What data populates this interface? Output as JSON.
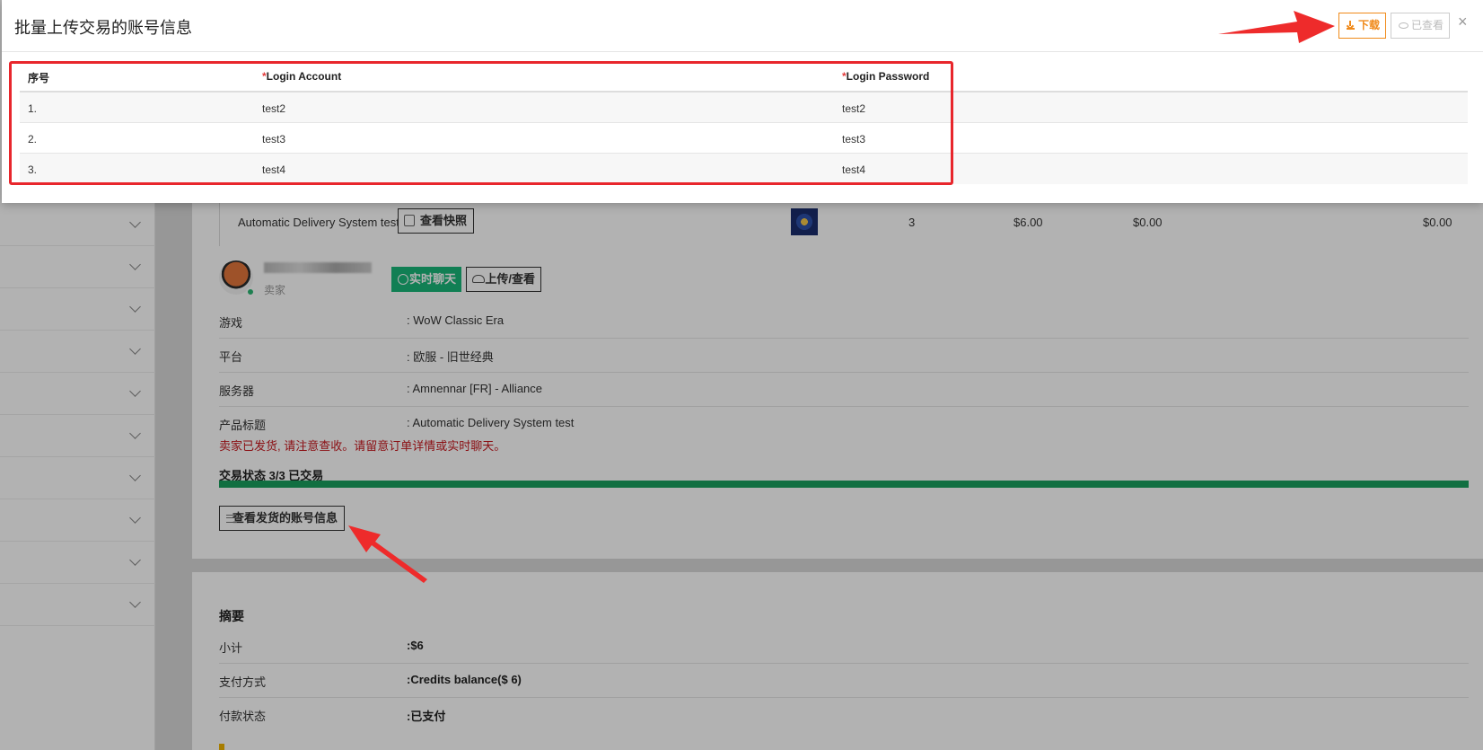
{
  "modal": {
    "title": "批量上传交易的账号信息",
    "download_label": "下载",
    "viewed_label": "已查看",
    "close_symbol": "×",
    "table": {
      "headers": {
        "index": "序号",
        "account": "Login Account",
        "password": "Login Password"
      },
      "required_mark": "*",
      "rows": [
        {
          "index": "1.",
          "account": "test2",
          "password": "test2"
        },
        {
          "index": "2.",
          "account": "test3",
          "password": "test3"
        },
        {
          "index": "3.",
          "account": "test4",
          "password": "test4"
        }
      ]
    }
  },
  "order": {
    "product_name": "Automatic Delivery System test",
    "snapshot_label": "查看快照",
    "quantity": "3",
    "price": "$6.00",
    "discount": "$0.00",
    "total": "$0.00",
    "seller_role": "卖家",
    "chat_label": "实时聊天",
    "upload_label": "上传/查看",
    "details": [
      {
        "key": "游戏",
        "value": ": WoW Classic Era"
      },
      {
        "key": "平台",
        "value": ": 欧服 - 旧世经典"
      },
      {
        "key": "服务器",
        "value": ": Amnennar [FR] - Alliance"
      },
      {
        "key": "产品标题",
        "value": ": Automatic Delivery System test"
      }
    ],
    "notice": "卖家已发货, 请注意查收。请留意订单详情或实时聊天。",
    "status": "交易状态 3/3 已交易",
    "progress": 1.0,
    "view_accounts_label": "查看发货的账号信息"
  },
  "summary": {
    "title": "摘要",
    "rows": [
      {
        "key": "小计",
        "value": ":$6"
      },
      {
        "key": "支付方式",
        "value": ":Credits balance($ 6)"
      },
      {
        "key": "付款状态",
        "value": ":已支付"
      }
    ]
  },
  "colors": {
    "accent_orange": "#f08a1a",
    "highlight_red": "#e8262c",
    "status_green": "#19a05e",
    "chat_green": "#19b679",
    "notice_red": "#c8171e"
  }
}
